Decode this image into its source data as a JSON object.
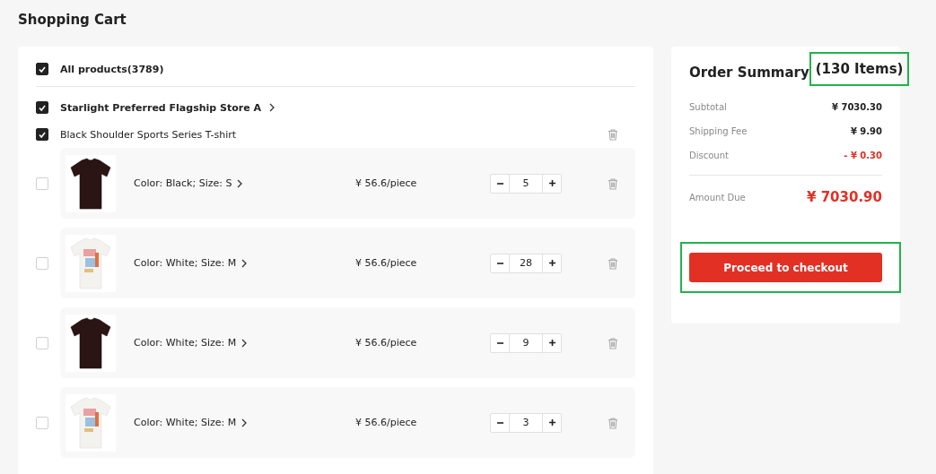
{
  "page_title": "Shopping Cart",
  "cart": {
    "all": {
      "label": "All products(3789)",
      "checked": true
    },
    "store": {
      "name": "Starlight Preferred Flagship Store A",
      "checked": true
    },
    "product": {
      "title": "Black Shoulder Sports Series T-shirt",
      "checked": true
    },
    "items": [
      {
        "variant": "Color: Black; Size: S",
        "price": "¥ 56.6/piece",
        "quantity": "5",
        "checked": false
      },
      {
        "variant": "Color: White; Size: M",
        "price": "¥ 56.6/piece",
        "quantity": "28",
        "checked": false
      },
      {
        "variant": "Color: White; Size: M",
        "price": "¥ 56.6/piece",
        "quantity": "9",
        "checked": false
      },
      {
        "variant": "Color: White; Size: M",
        "price": "¥ 56.6/piece",
        "quantity": "3",
        "checked": false
      }
    ]
  },
  "summary": {
    "title": "Order Summary",
    "count": "(130 Items)",
    "rows": [
      {
        "label": "Subtotal",
        "value": "¥ 7030.30",
        "kind": "normal"
      },
      {
        "label": "Shipping Fee",
        "value": "¥ 9.90",
        "kind": "normal"
      },
      {
        "label": "Discount",
        "value": "- ¥ 0.30",
        "kind": "discount"
      }
    ],
    "total": {
      "label": "Amount Due",
      "value": "¥ 7030.90"
    },
    "checkout": "Proceed to checkout"
  }
}
